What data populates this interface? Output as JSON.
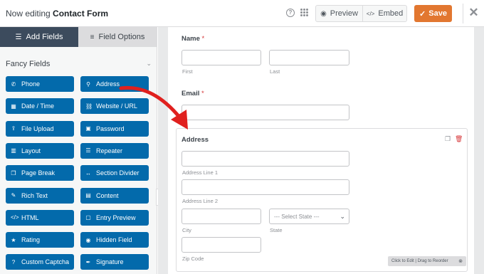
{
  "header": {
    "editing_prefix": "Now editing",
    "form_name": "Contact Form",
    "help_glyph": "?",
    "preview_label": "Preview",
    "embed_label": "Embed",
    "save_label": "Save",
    "close_glyph": "✕",
    "save_color": "#e27730"
  },
  "sidebar": {
    "tabs": [
      {
        "label": "Add Fields",
        "icon": "list-icon",
        "active": true
      },
      {
        "label": "Field Options",
        "icon": "sliders-icon",
        "active": false
      }
    ],
    "section_title": "Fancy Fields",
    "button_color": "#036aab",
    "fields": [
      {
        "label": "Phone",
        "icon": "phone-icon",
        "glyph": "✆"
      },
      {
        "label": "Address",
        "icon": "map-pin-icon",
        "glyph": "⚲"
      },
      {
        "label": "Date / Time",
        "icon": "calendar-icon",
        "glyph": "▦"
      },
      {
        "label": "Website / URL",
        "icon": "link-icon",
        "glyph": "⛓"
      },
      {
        "label": "File Upload",
        "icon": "upload-icon",
        "glyph": "⇪"
      },
      {
        "label": "Password",
        "icon": "lock-icon",
        "glyph": "▣"
      },
      {
        "label": "Layout",
        "icon": "layout-icon",
        "glyph": "▥"
      },
      {
        "label": "Repeater",
        "icon": "repeater-icon",
        "glyph": "☰"
      },
      {
        "label": "Page Break",
        "icon": "copy-icon",
        "glyph": "❐"
      },
      {
        "label": "Section Divider",
        "icon": "divider-icon",
        "glyph": "↔"
      },
      {
        "label": "Rich Text",
        "icon": "edit-icon",
        "glyph": "✎"
      },
      {
        "label": "Content",
        "icon": "content-icon",
        "glyph": "▤"
      },
      {
        "label": "HTML",
        "icon": "code-icon",
        "glyph": "</>"
      },
      {
        "label": "Entry Preview",
        "icon": "preview-icon",
        "glyph": "▢"
      },
      {
        "label": "Rating",
        "icon": "star-icon",
        "glyph": "★"
      },
      {
        "label": "Hidden Field",
        "icon": "eye-slash-icon",
        "glyph": "◉"
      },
      {
        "label": "Custom Captcha",
        "icon": "question-icon",
        "glyph": "?"
      },
      {
        "label": "Signature",
        "icon": "pen-icon",
        "glyph": "✒"
      }
    ]
  },
  "form": {
    "name_label": "Name",
    "required_mark": "*",
    "first_sub": "First",
    "last_sub": "Last",
    "email_label": "Email",
    "address": {
      "label": "Address",
      "line1_sub": "Address Line 1",
      "line2_sub": "Address Line 2",
      "city_sub": "City",
      "state_sub": "State",
      "state_placeholder": "--- Select State ---",
      "zip_sub": "Zip Code",
      "reorder_hint": "Click to Edit | Drag to Reorder"
    }
  }
}
